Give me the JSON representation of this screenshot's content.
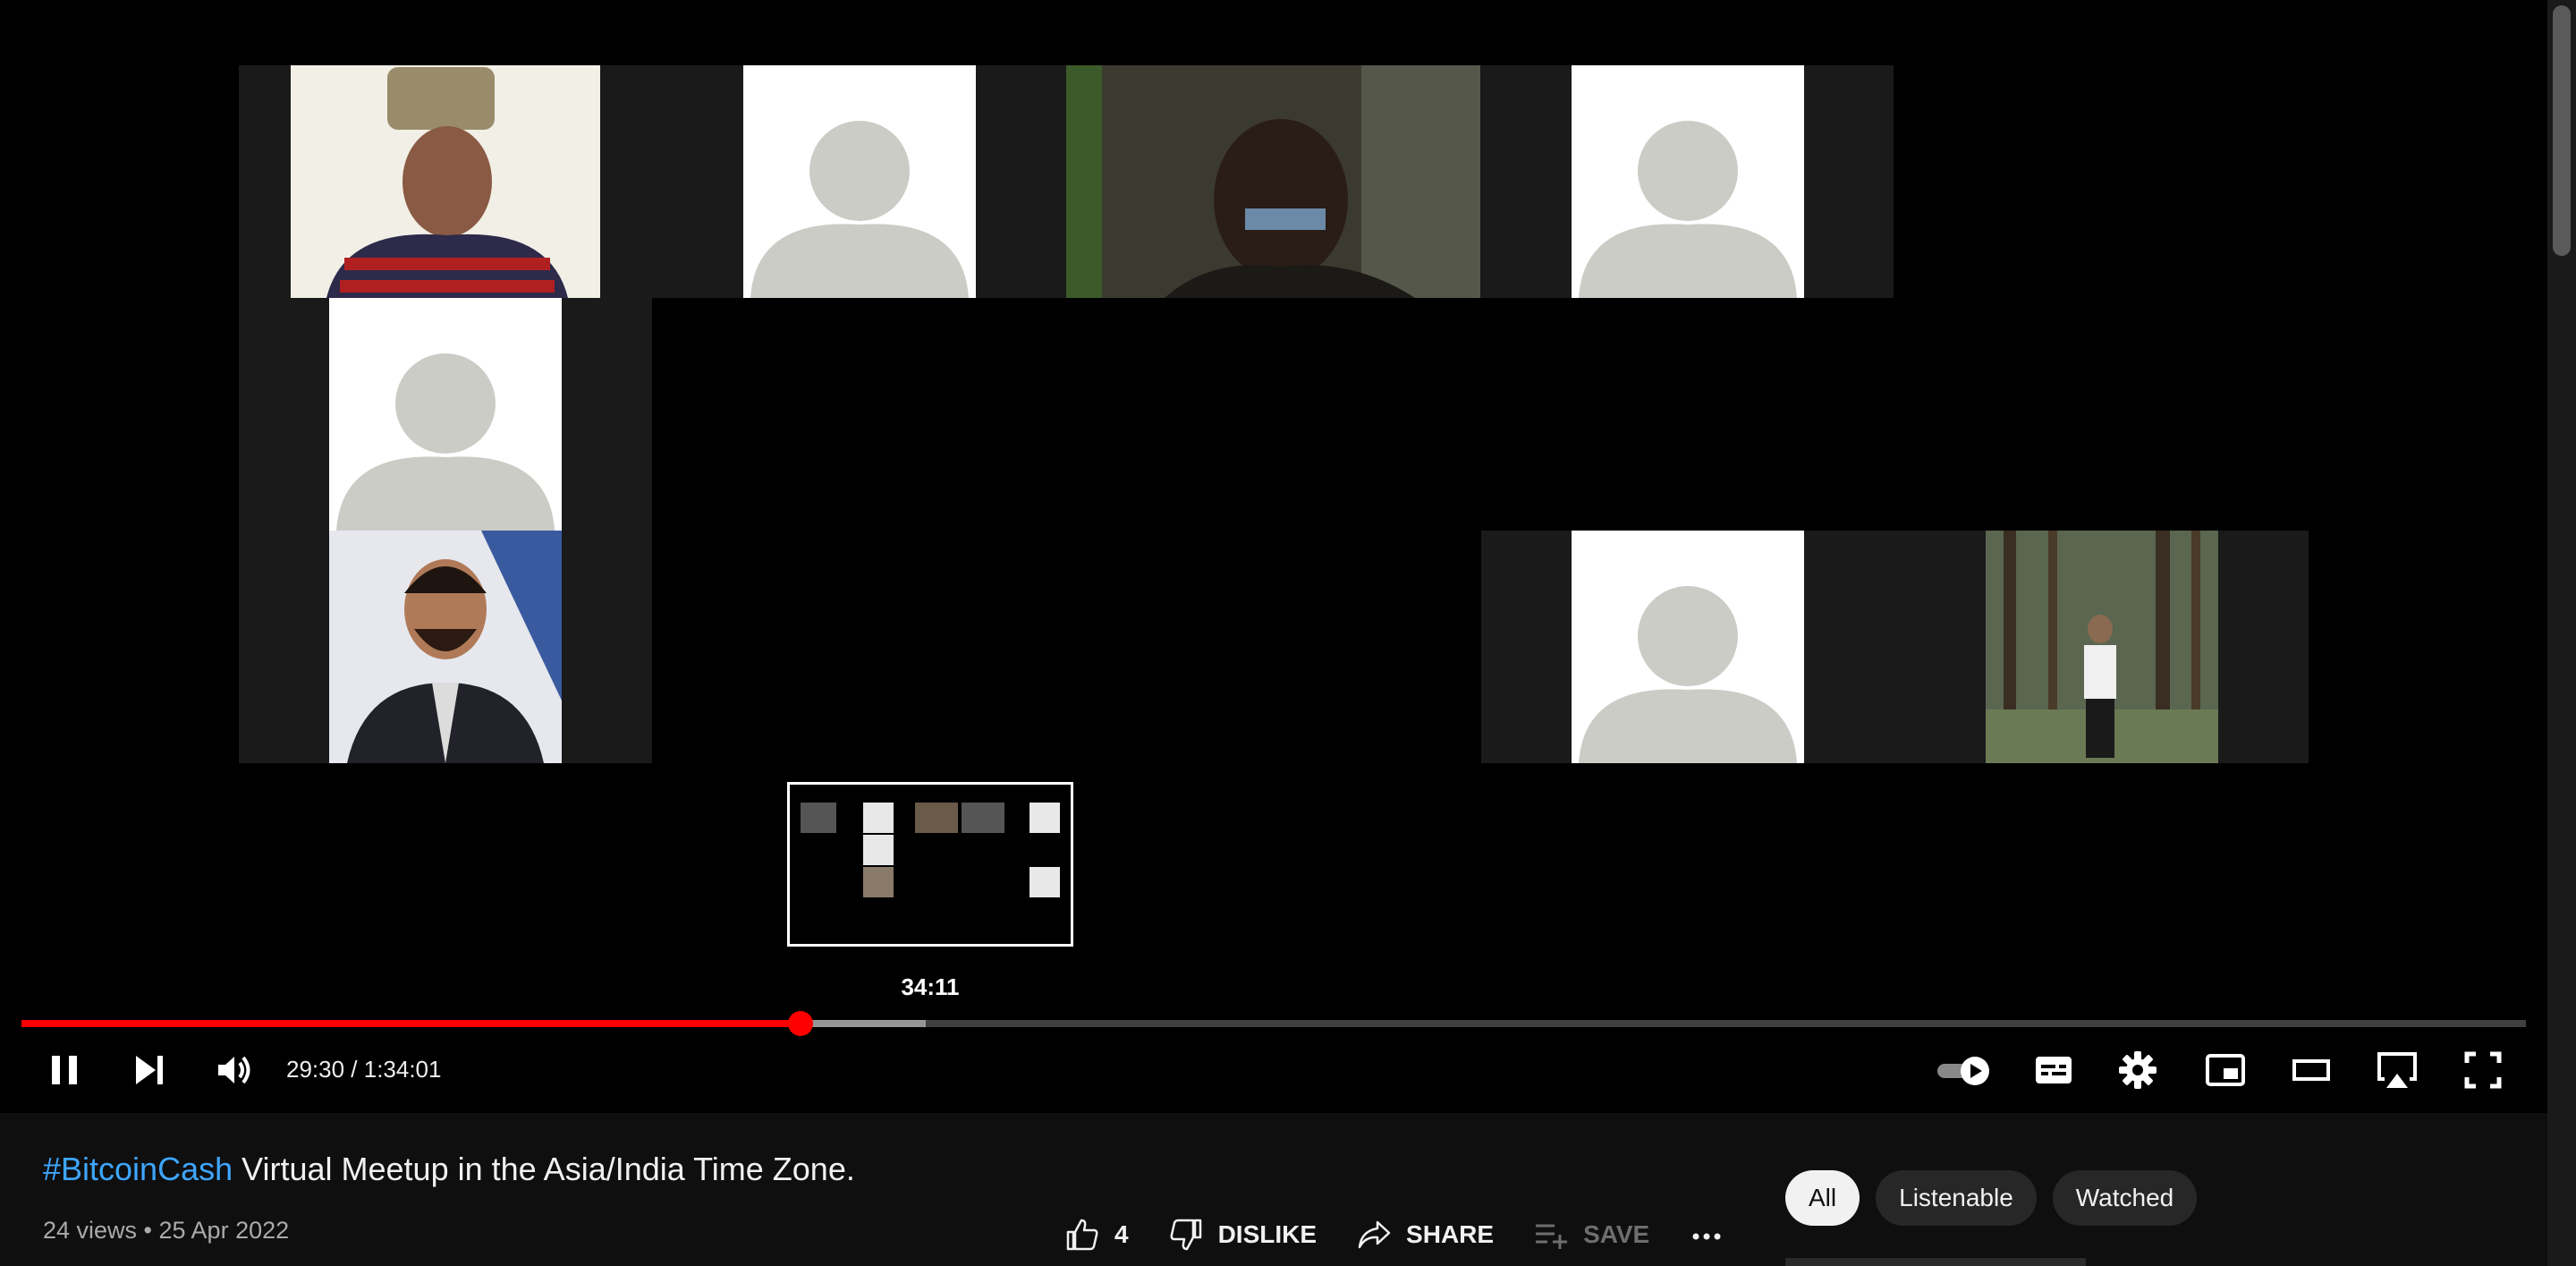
{
  "player": {
    "preview_time": "34:11",
    "current_time": "29:30",
    "duration": "1:34:01",
    "time_display": "29:30 / 1:34:01",
    "played_fraction": 0.311,
    "buffered_fraction": 0.361,
    "accent_color": "#ff0000",
    "controls": [
      {
        "name": "pause-icon"
      },
      {
        "name": "next-icon"
      },
      {
        "name": "volume-icon"
      },
      {
        "name": "autoplay-toggle-icon"
      },
      {
        "name": "subtitles-icon"
      },
      {
        "name": "settings-icon"
      },
      {
        "name": "miniplayer-icon"
      },
      {
        "name": "theater-mode-icon"
      },
      {
        "name": "airplay-icon"
      },
      {
        "name": "fullscreen-icon"
      }
    ]
  },
  "video": {
    "hashtag": "#BitcoinCash",
    "title_rest": " Virtual Meetup in the Asia/India Time Zone.",
    "views": "24 views",
    "date": "25 Apr 2022",
    "meta": "24 views • 25 Apr 2022"
  },
  "actions": {
    "likes": "4",
    "dislike_label": "DISLIKE",
    "share_label": "SHARE",
    "save_label": "SAVE"
  },
  "chips": [
    "All",
    "Listenable",
    "Watched"
  ],
  "colors": {
    "link": "#3ea6ff",
    "background": "#0f0f0f",
    "chip": "#272727"
  }
}
